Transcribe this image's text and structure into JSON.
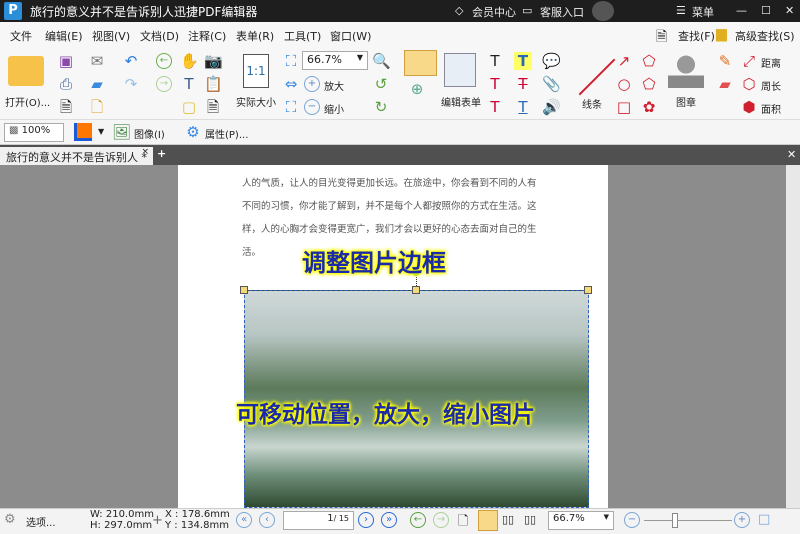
{
  "title": {
    "app_title": "旅行的意义并不是告诉别人迅捷PDF编辑器",
    "logo": "P",
    "vip": "会员中心",
    "service": "客服入口",
    "menu": "菜单"
  },
  "menu": [
    "文件",
    "编辑(E)",
    "视图(V)",
    "文档(D)",
    "注释(C)",
    "表单(R)",
    "工具(T)",
    "窗口(W)"
  ],
  "toolbar": {
    "open": "打开(O)...",
    "actual_size": "实际大小",
    "zoom_value": "66.7%",
    "zoom_in": "放大",
    "zoom_out": "缩小",
    "edit_form": "编辑表单",
    "lines": "线条",
    "stamp": "图章",
    "distance": "距离",
    "perimeter": "周长",
    "area": "面积",
    "find": "查找(F)",
    "advanced_find": "高级查找(S)"
  },
  "toolbar2": {
    "opacity": "100%",
    "image": "图像(I)",
    "properties": "属性(P)..."
  },
  "tab": {
    "label": "旅行的意义并不是告诉别人 *"
  },
  "document": {
    "paragraphs": [
      "人的气质，让人的目光变得更加长远。在旅途中，你会看到不同的人有",
      "不同的习惯，你才能了解到，并不是每个人都按照你的方式在生活。这",
      "样，人的心胸才会变得更宽广，我们才会以更好的心态去面对自己的生",
      "活。"
    ],
    "caption_top": "调整图片边框",
    "caption_mid": "可移动位置，放大，缩小图片"
  },
  "status": {
    "options": "选项...",
    "width": "W: 210.0mm",
    "height": "H: 297.0mm",
    "x": "X : 178.6mm",
    "y": "Y : 134.8mm",
    "page": "1",
    "pages": "/ 15",
    "zoom": "66.7%"
  },
  "colors": {
    "accent": "#2a8fd8",
    "fill": "#ff7700"
  }
}
